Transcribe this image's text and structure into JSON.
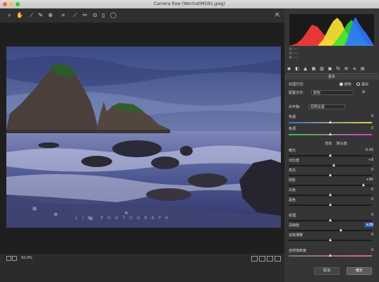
{
  "window": {
    "title": "Camera Raw (WechatIMG91.jpeg)"
  },
  "toolbar": {
    "tools": [
      "zoom-icon",
      "hand-icon",
      "white-balance-icon",
      "color-sampler-icon",
      "target-adjust-icon",
      "crop-icon",
      "straighten-icon",
      "spot-removal-icon",
      "red-eye-icon",
      "adjustment-brush-icon",
      "graduated-filter-icon",
      "radial-filter-icon"
    ]
  },
  "photo": {
    "watermark": "LIN PHOTOGRAPH"
  },
  "bottom": {
    "zoom": "92.0%",
    "cancel": "取消",
    "done": "確定"
  },
  "histogram": {
    "readouts": [
      "R:",
      "G:",
      "B:"
    ],
    "dash": "----"
  },
  "panel": {
    "section_basic": "基本",
    "process_label": "处理方式:",
    "process_color": "颜色",
    "process_bw": "黑白",
    "profile_label": "配置文件:",
    "profile_value": "颜色",
    "wb_label": "白平衡:",
    "wb_value": "原照设置",
    "temp_label": "色温",
    "temp_value": "0",
    "tint_label": "色调",
    "tint_value": "0",
    "auto": "自动",
    "default": "默认值",
    "exposure_label": "曝光",
    "exposure_value": "0.00",
    "contrast_label": "对比度",
    "contrast_value": "+8",
    "highlights_label": "高光",
    "highlights_value": "0",
    "shadows_label": "阴影",
    "shadows_value": "+80",
    "whites_label": "白色",
    "whites_value": "0",
    "blacks_label": "黑色",
    "blacks_value": "0",
    "texture_label": "纹理",
    "texture_value": "0",
    "clarity_label": "清晰度",
    "clarity_value": "+26",
    "dehaze_label": "去除薄雾",
    "dehaze_value": "0",
    "vibrance_label": "自然饱和度",
    "vibrance_value": "0"
  },
  "colors": {
    "accent": "#2c6fd0"
  }
}
